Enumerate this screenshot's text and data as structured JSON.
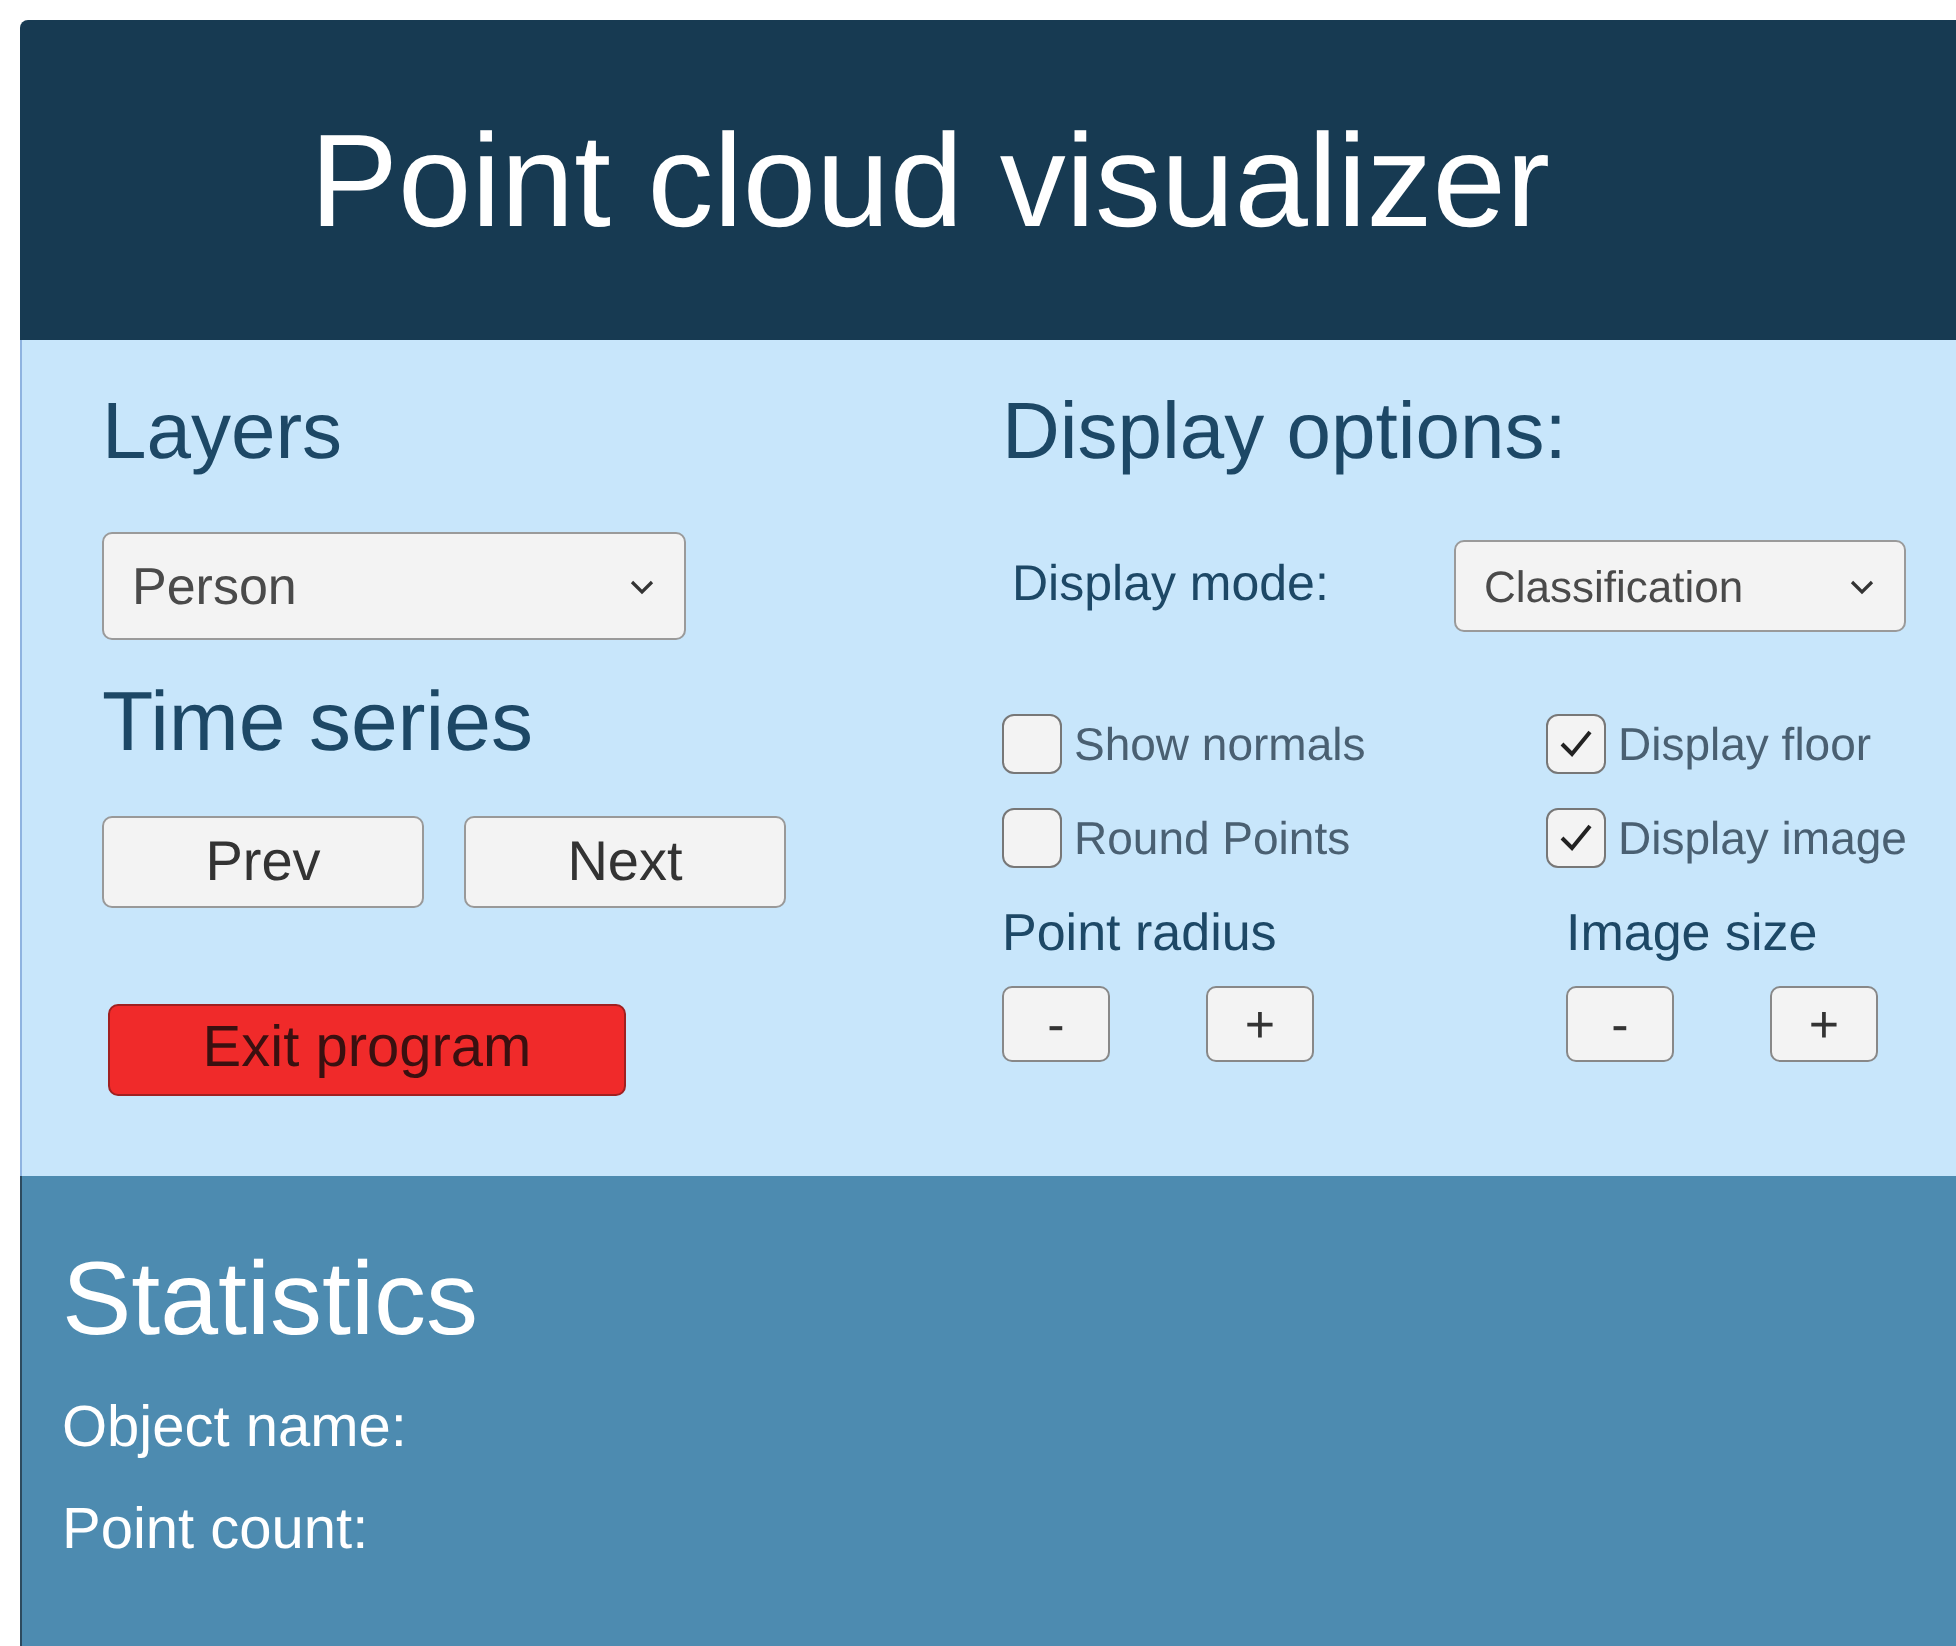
{
  "header": {
    "title": "Point cloud visualizer"
  },
  "layers": {
    "heading": "Layers",
    "dropdown": {
      "value": "Person"
    }
  },
  "time_series": {
    "heading": "Time series",
    "buttons": [
      "Prev",
      "Next"
    ]
  },
  "exit_button": "Exit program",
  "display_options": {
    "heading": "Display options:",
    "mode_label": "Display mode:",
    "mode_dropdown": {
      "value": "Classification"
    },
    "checkboxes": [
      {
        "label": "Show normals",
        "checked": false
      },
      {
        "label": "Display floor",
        "checked": true
      },
      {
        "label": "Round Points",
        "checked": false
      },
      {
        "label": "Display image",
        "checked": true
      }
    ],
    "steppers": [
      {
        "label": "Point radius",
        "buttons": [
          "-",
          "+"
        ]
      },
      {
        "label": "Image size",
        "buttons": [
          "-",
          "+"
        ]
      }
    ]
  },
  "statistics": {
    "heading": "Statistics",
    "lines": [
      "Object name:",
      "Point count:"
    ]
  }
}
